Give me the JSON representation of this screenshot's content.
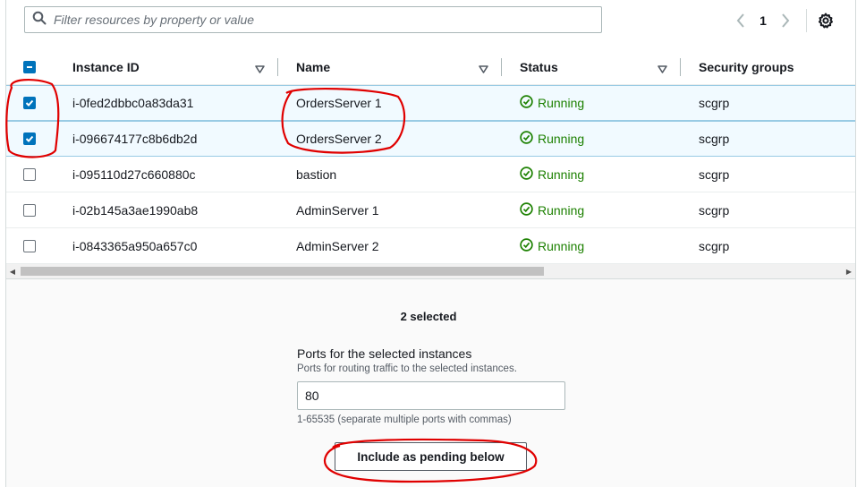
{
  "filter": {
    "placeholder": "Filter resources by property or value"
  },
  "pagination": {
    "current_page": "1"
  },
  "table": {
    "columns": [
      "Instance ID",
      "Name",
      "Status",
      "Security groups"
    ],
    "rows": [
      {
        "id": "i-0fed2dbbc0a83da31",
        "name": "OrdersServer 1",
        "status": "Running",
        "sg": "scgrp",
        "selected": true
      },
      {
        "id": "i-096674177c8b6db2d",
        "name": "OrdersServer 2",
        "status": "Running",
        "sg": "scgrp",
        "selected": true
      },
      {
        "id": "i-095110d27c660880c",
        "name": "bastion",
        "status": "Running",
        "sg": "scgrp",
        "selected": false
      },
      {
        "id": "i-02b145a3ae1990ab8",
        "name": "AdminServer 1",
        "status": "Running",
        "sg": "scgrp",
        "selected": false
      },
      {
        "id": "i-0843365a950a657c0",
        "name": "AdminServer 2",
        "status": "Running",
        "sg": "scgrp",
        "selected": false
      }
    ]
  },
  "selection": {
    "count_text": "2 selected"
  },
  "ports": {
    "label": "Ports for the selected instances",
    "description": "Ports for routing traffic to the selected instances.",
    "value": "80",
    "hint": "1-65535 (separate multiple ports with commas)"
  },
  "actions": {
    "include_pending": "Include as pending below"
  },
  "colors": {
    "accent": "#0073bb",
    "running": "#1d8102",
    "annotation": "#e00000"
  }
}
